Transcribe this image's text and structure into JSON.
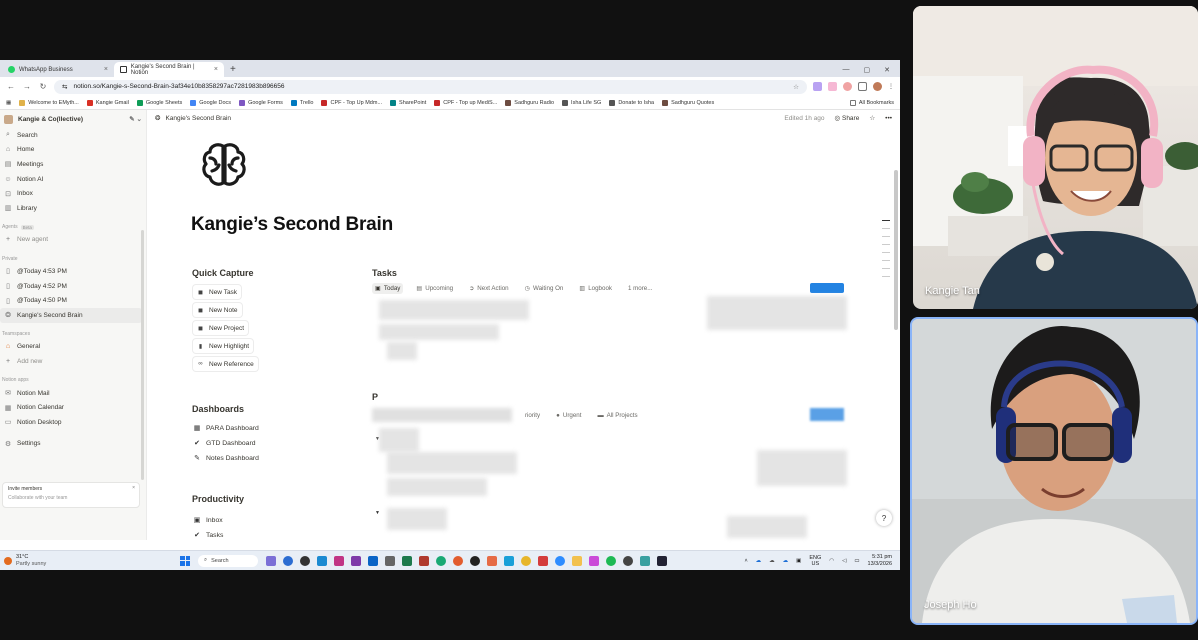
{
  "browser": {
    "tabs": [
      {
        "label": "WhatsApp Business",
        "icon": "whatsapp-icon"
      },
      {
        "label": "Kangie's Second Brain | Notion",
        "icon": "notion-icon"
      }
    ],
    "url": "notion.so/Kangie-s-Second-Brain-3af34e10b8358297ac7281983b896656",
    "bookmarks": [
      "Welcome to EMyth...",
      "Kangie Gmail",
      "Google Sheets",
      "Google Docs",
      "Google Forms",
      "Trello",
      "CPF - Top Up Mdm...",
      "SharePoint",
      "CPF - Top up MediS...",
      "Sadhguru Radio",
      "Isha Life SG",
      "Donate to Isha",
      "Sadhguru Quotes"
    ],
    "all_bookmarks": "All Bookmarks"
  },
  "sidebar": {
    "workspace": "Kangie & Co(llective)",
    "nav": [
      "Search",
      "Home",
      "Meetings",
      "Notion AI",
      "Inbox",
      "Library"
    ],
    "agents_head": "Agents",
    "beta": "Beta",
    "new_agent": "New agent",
    "private_head": "Private",
    "private_items": [
      "@Today 4:53 PM",
      "@Today 4:52 PM",
      "@Today 4:50 PM",
      "Kangie's Second Brain"
    ],
    "teamspaces_head": "Teamspaces",
    "general": "General",
    "add_new": "Add new",
    "apps_head": "Notion apps",
    "apps": [
      "Notion Mail",
      "Notion Calendar",
      "Notion Desktop"
    ],
    "settings": "Settings",
    "invite_title": "Invite members",
    "invite_sub": "Collaborate with your team"
  },
  "page": {
    "breadcrumb": "Kangie's Second Brain",
    "edited": "Edited 1h ago",
    "share": "Share",
    "title": "Kangie’s Second Brain",
    "quick_capture": "Quick Capture",
    "capture_buttons": [
      "New Task",
      "New Note",
      "New Project",
      "New Highlight",
      "New Reference"
    ],
    "dashboards": "Dashboards",
    "dashboard_links": [
      "PARA Dashboard",
      "GTD Dashboard",
      "Notes Dashboard"
    ],
    "productivity": "Productivity",
    "productivity_links": [
      "Inbox",
      "Tasks"
    ],
    "tasks": "Tasks",
    "task_views": [
      "Today",
      "Upcoming",
      "Next Action",
      "Waiting On",
      "Logbook",
      "1 more..."
    ],
    "projects_letter": "P",
    "project_views": [
      "riority",
      "Urgent",
      "All Projects"
    ]
  },
  "taskbar": {
    "temp": "31°C",
    "weather": "Partly sunny",
    "search": "Search",
    "lang1": "ENG",
    "lang2": "US",
    "time": "5:31 pm",
    "date": "13/3/2026"
  },
  "participants": [
    {
      "name": "Kangie Tan"
    },
    {
      "name": "Joseph Ho"
    }
  ]
}
